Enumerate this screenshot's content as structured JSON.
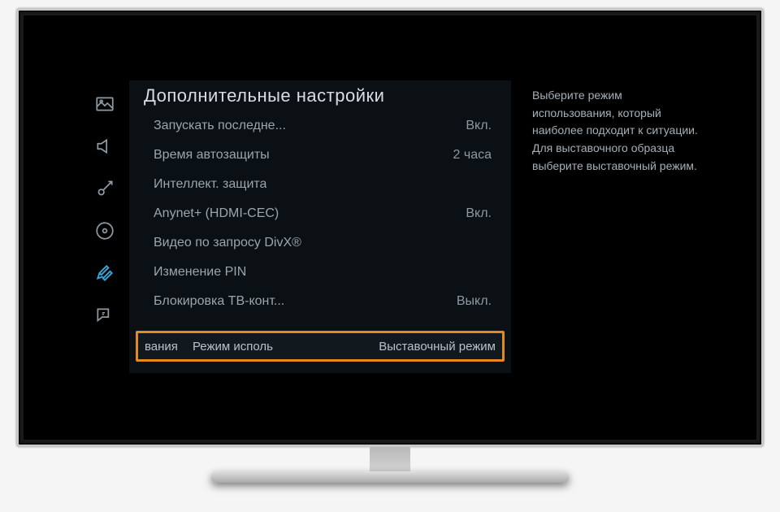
{
  "menu": {
    "title": "Дополнительные настройки",
    "items": [
      {
        "label": "Запускать последне...",
        "value": "Вкл."
      },
      {
        "label": "Время автозащиты",
        "value": "2 часа"
      },
      {
        "label": "Интеллект. защита",
        "value": ""
      },
      {
        "label": "Anynet+ (HDMI-CEC)",
        "value": "Вкл."
      },
      {
        "label": "Видео по запросу DivX®",
        "value": ""
      },
      {
        "label": "Изменение PIN",
        "value": ""
      },
      {
        "label": "Блокировка ТВ-конт...",
        "value": "Выкл."
      }
    ],
    "highlight": {
      "left": "вания",
      "mid": "Режим исполь",
      "right": "Выставочный режим"
    }
  },
  "description": "Выберите режим использования, который наиболее подходит к ситуации. Для выставочного образца выберите выставочный режим.",
  "side_icons": [
    {
      "name": "picture-icon"
    },
    {
      "name": "sound-icon"
    },
    {
      "name": "broadcast-icon"
    },
    {
      "name": "network-icon"
    },
    {
      "name": "system-icon"
    },
    {
      "name": "support-icon"
    }
  ]
}
